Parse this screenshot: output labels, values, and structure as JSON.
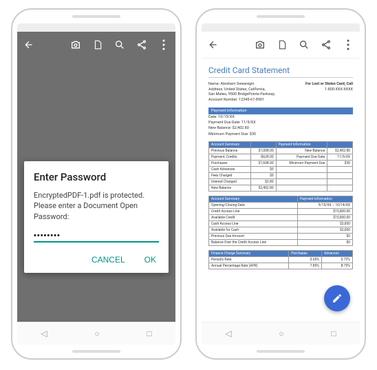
{
  "left": {
    "dialog": {
      "title": "Enter Password",
      "message": "EncryptedPDF-1.pdf is protected. Please enter a Document Open Password:",
      "value": "••••••••",
      "cancel": "CANCEL",
      "ok": "OK"
    }
  },
  "right": {
    "doc": {
      "title": "Credit Card Statement",
      "header": {
        "name": "Name: Abraham Swearegin",
        "address": "Address: United States, California,",
        "city": "San Mateo, 9500 BridgePointe Parkway,",
        "acct": "Account Number: 12345-67-8901",
        "lostLabel": "For Lost or Stolen Card, Call",
        "lostPhone": "1-800-XXX-XXXX"
      },
      "paymentInfoBar": "Payment Information",
      "paymentInfo": {
        "l1": "Date: 10/15/XX",
        "l2": "Payment Due Date: 11/5/XX",
        "l3": "New Balance: $2,402.80",
        "l4": "Minimum Payment Due: $30"
      },
      "summaryTable": {
        "h1": "Account Summary",
        "h2": "",
        "h3": "Payment Information",
        "h4": "",
        "rows": [
          [
            "Previous Balance",
            "$1,008.00",
            "New Balance",
            "$2,402.80"
          ],
          [
            "Payment, Credits",
            "-$628.00",
            "Payment Due Date",
            "11/5/XX"
          ],
          [
            "Purchases",
            "$1,608.00",
            "Minimum Payment Due",
            "$30"
          ],
          [
            "Cash Advances",
            "$0",
            "",
            ""
          ],
          [
            "Fees Charged",
            "$0",
            "",
            ""
          ],
          [
            "Interest Charged",
            "$2.80",
            "",
            ""
          ],
          [
            "New Balance",
            "$2,402.80",
            "",
            ""
          ]
        ]
      },
      "detailTable": {
        "h1": "Account Summary",
        "h2": "Payment Information",
        "rows": [
          [
            "Opening/Closing Date",
            "9/15/XX – 10/14/XX"
          ],
          [
            "Credit Access Line",
            "$15,000.00"
          ],
          [
            "Available Credit",
            "$15,000.00"
          ],
          [
            "Cash Access Line",
            "$2,000"
          ],
          [
            "Available for Cash",
            "$2,000"
          ],
          [
            "Previous Due Amount",
            "$0"
          ],
          [
            "Balance Over the Credit Access Line",
            "$0"
          ]
        ]
      },
      "financeTable": {
        "h1": "Finance Charge Summary",
        "h2": "Purchases",
        "h3": "Advances",
        "rows": [
          [
            "Periodic Rate",
            "0.65%",
            "0.73%"
          ],
          [
            "Annual Percentage Rate (APR)",
            "7.85%",
            "8.75%"
          ]
        ]
      }
    }
  }
}
